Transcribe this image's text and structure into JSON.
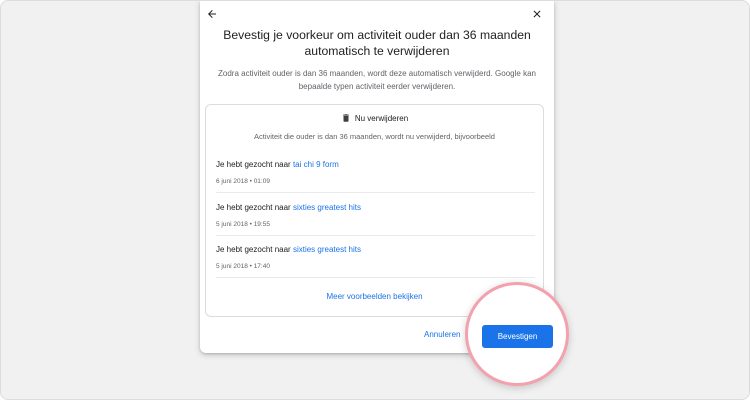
{
  "dialog": {
    "title": "Bevestig je voorkeur om activiteit ouder dan 36 maanden automatisch te verwijderen",
    "description": "Zodra activiteit ouder is dan 36 maanden, wordt deze automatisch verwijderd. Google kan bepaalde typen activiteit eerder verwijderen.",
    "back_icon": "arrow-back-icon",
    "close_icon": "close-icon"
  },
  "card": {
    "header_icon": "trash-icon",
    "header_label": "Nu verwijderen",
    "subtitle": "Activiteit die ouder is dan 36 maanden, wordt nu verwijderd, bijvoorbeeld",
    "items": [
      {
        "prefix": "Je hebt gezocht naar",
        "query": "tai chi 9 form",
        "date": "6 juni 2018 • 01:09"
      },
      {
        "prefix": "Je hebt gezocht naar",
        "query": "sixties greatest hits",
        "date": "5 juni 2018 • 19:55"
      },
      {
        "prefix": "Je hebt gezocht naar",
        "query": "sixties greatest hits",
        "date": "5 juni 2018 • 17:40"
      }
    ],
    "more_link": "Meer voorbeelden bekijken"
  },
  "actions": {
    "cancel_label": "Annuleren",
    "confirm_label": "Bevestigen"
  },
  "colors": {
    "accent": "#1a73e8",
    "highlight_ring": "#f3a1ac"
  }
}
